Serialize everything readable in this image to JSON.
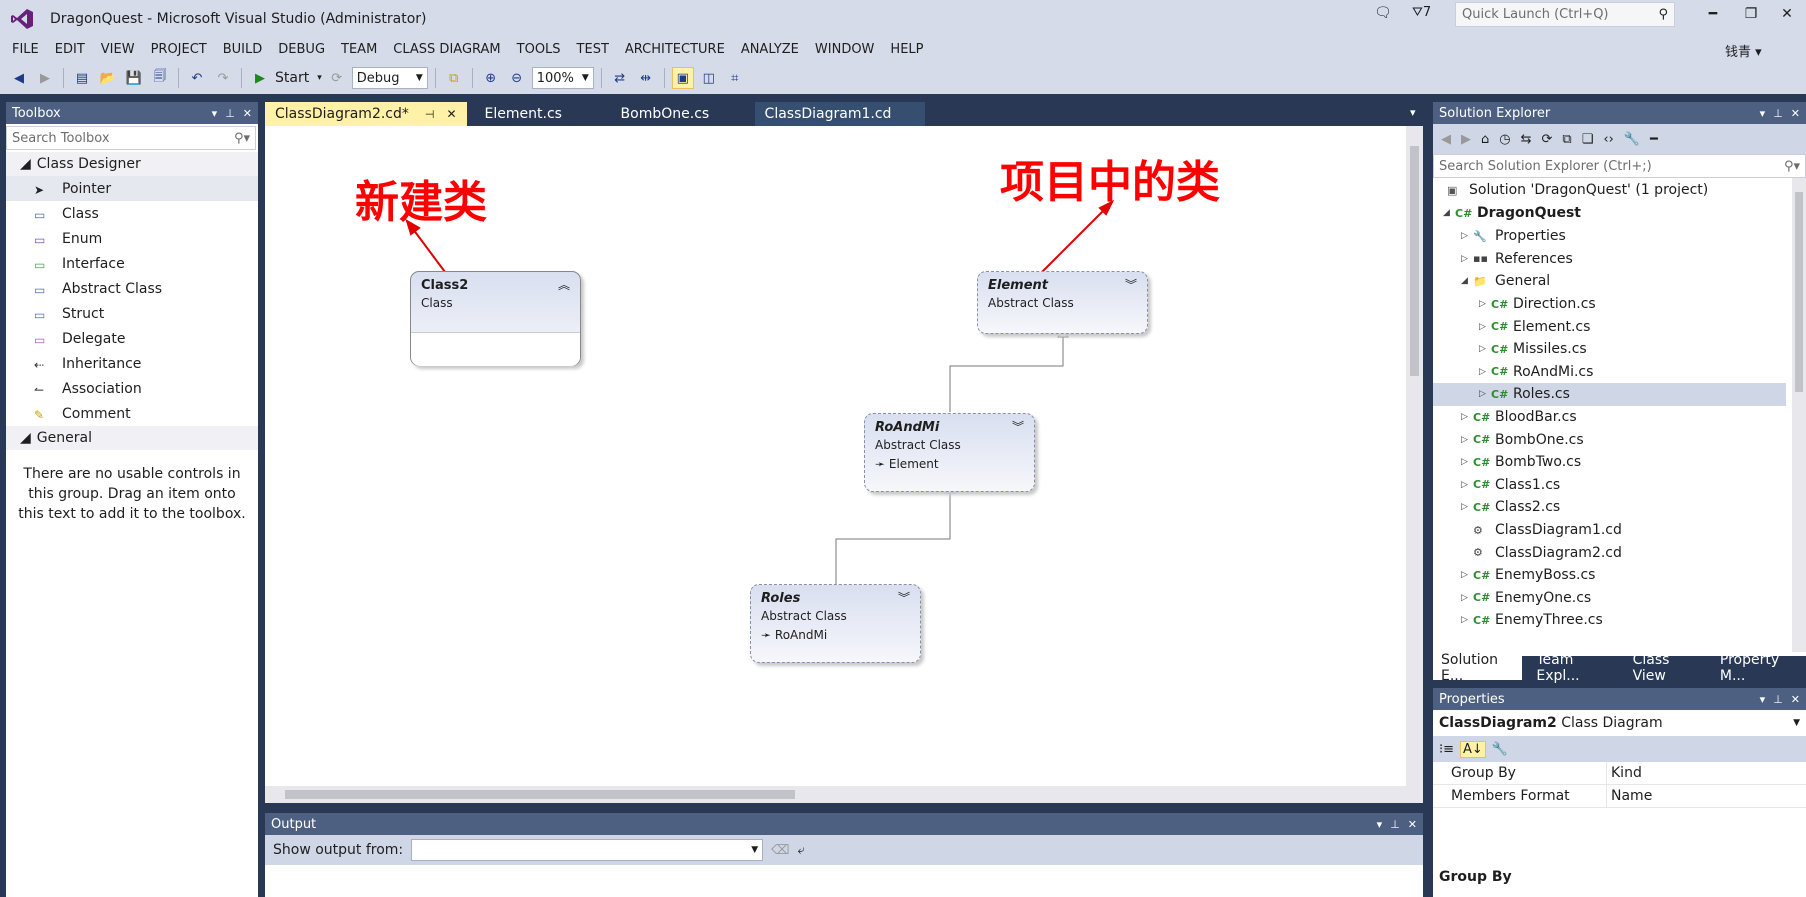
{
  "window": {
    "title": "DragonQuest - Microsoft Visual Studio (Administrator)",
    "notif_count": "7",
    "quick_launch_placeholder": "Quick Launch (Ctrl+Q)",
    "user": "钱青"
  },
  "menu": [
    "FILE",
    "EDIT",
    "VIEW",
    "PROJECT",
    "BUILD",
    "DEBUG",
    "TEAM",
    "CLASS DIAGRAM",
    "TOOLS",
    "TEST",
    "ARCHITECTURE",
    "ANALYZE",
    "WINDOW",
    "HELP"
  ],
  "toolbar": {
    "start_label": "Start",
    "config": "Debug",
    "zoom": "100%"
  },
  "toolbox": {
    "title": "Toolbox",
    "search_placeholder": "Search Toolbox",
    "group1": "Class Designer",
    "items": [
      {
        "label": "Pointer",
        "icon": "pointer-icon"
      },
      {
        "label": "Class",
        "icon": "class-icon"
      },
      {
        "label": "Enum",
        "icon": "enum-icon"
      },
      {
        "label": "Interface",
        "icon": "interface-icon"
      },
      {
        "label": "Abstract Class",
        "icon": "abstract-class-icon"
      },
      {
        "label": "Struct",
        "icon": "struct-icon"
      },
      {
        "label": "Delegate",
        "icon": "delegate-icon"
      },
      {
        "label": "Inheritance",
        "icon": "inheritance-icon"
      },
      {
        "label": "Association",
        "icon": "association-icon"
      },
      {
        "label": "Comment",
        "icon": "comment-icon"
      }
    ],
    "group2": "General",
    "empty_msg": "There are no usable controls in this group. Drag an item onto this text to add it to the toolbox."
  },
  "tabs": [
    {
      "label": "ClassDiagram2.cd*",
      "active": true
    },
    {
      "label": "Element.cs"
    },
    {
      "label": "BombOne.cs"
    },
    {
      "label": "ClassDiagram1.cd"
    }
  ],
  "diagram": {
    "annotation_new": "新建类",
    "annotation_existing": "项目中的类",
    "shapes": {
      "class2": {
        "name": "Class2",
        "kind": "Class"
      },
      "element": {
        "name": "Element",
        "kind": "Abstract Class"
      },
      "roandmi": {
        "name": "RoAndMi",
        "kind": "Abstract Class",
        "base": "Element"
      },
      "roles": {
        "name": "Roles",
        "kind": "Abstract Class",
        "base": "RoAndMi"
      }
    }
  },
  "output": {
    "title": "Output",
    "show_from": "Show output from:"
  },
  "solution_explorer": {
    "title": "Solution Explorer",
    "search_placeholder": "Search Solution Explorer (Ctrl+;)",
    "solution": "Solution 'DragonQuest' (1 project)",
    "project": "DragonQuest",
    "items": [
      {
        "label": "Properties"
      },
      {
        "label": "References"
      },
      {
        "label": "General"
      },
      {
        "label": "Direction.cs"
      },
      {
        "label": "Element.cs"
      },
      {
        "label": "Missiles.cs"
      },
      {
        "label": "RoAndMi.cs"
      },
      {
        "label": "Roles.cs"
      },
      {
        "label": "BloodBar.cs"
      },
      {
        "label": "BombOne.cs"
      },
      {
        "label": "BombTwo.cs"
      },
      {
        "label": "Class1.cs"
      },
      {
        "label": "Class2.cs"
      },
      {
        "label": "ClassDiagram1.cd"
      },
      {
        "label": "ClassDiagram2.cd"
      },
      {
        "label": "EnemyBoss.cs"
      },
      {
        "label": "EnemyOne.cs"
      },
      {
        "label": "EnemyThree.cs"
      }
    ],
    "bottom_tabs": [
      "Solution E...",
      "Team Expl...",
      "Class View",
      "Property M..."
    ]
  },
  "properties": {
    "title": "Properties",
    "object_name": "ClassDiagram2",
    "object_type": "Class Diagram",
    "rows": [
      {
        "key": "Group By",
        "value": "Kind"
      },
      {
        "key": "Members Format",
        "value": "Name"
      }
    ],
    "desc_title": "Group By"
  }
}
